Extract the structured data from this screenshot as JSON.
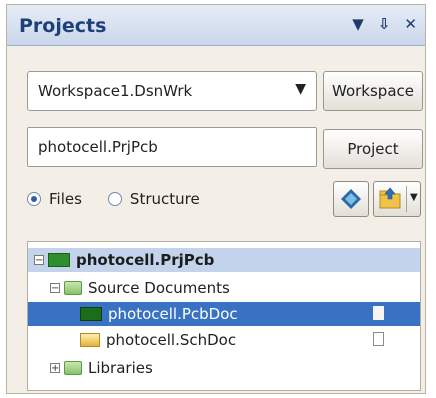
{
  "panel": {
    "title": "Projects",
    "title_controls": [
      "▼",
      "⇩",
      "✕"
    ]
  },
  "workspace": {
    "selected": "Workspace1.DsnWrk",
    "button_label": "Workspace"
  },
  "project": {
    "value": "photocell.PrjPcb",
    "button_label": "Project"
  },
  "view_mode": {
    "options": [
      "Files",
      "Structure"
    ],
    "selected": "Files"
  },
  "tree": {
    "items": [
      {
        "label": "photocell.PrjPcb",
        "icon": "project-icon",
        "expander": "−"
      },
      {
        "label": "Source Documents",
        "icon": "folder-icon",
        "expander": "−"
      },
      {
        "label": "photocell.PcbDoc",
        "icon": "pcb-document-icon"
      },
      {
        "label": "photocell.SchDoc",
        "icon": "schematic-document-icon"
      },
      {
        "label": "Libraries",
        "icon": "folder-icon",
        "expander": "+"
      }
    ]
  },
  "colors": {
    "title_text": "#1f3f78",
    "selection": "#3a72c3",
    "project_highlight": "#c3d3ec"
  }
}
